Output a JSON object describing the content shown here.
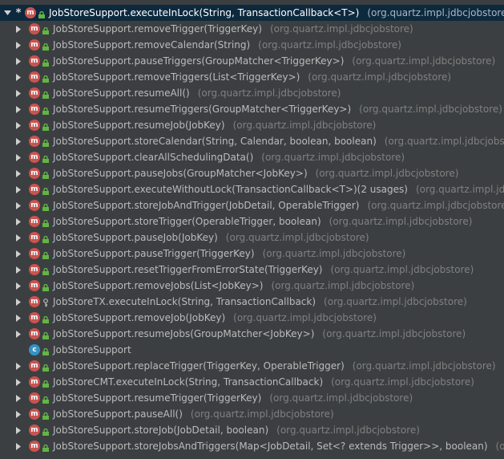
{
  "colors": {
    "background": "#3c3f41",
    "selection": "#0d293e",
    "method_badge": "#c75450",
    "class_badge": "#3592c4",
    "lock_icon": "#62b543",
    "text": "#bbbbbb",
    "package_text": "#808080"
  },
  "root": {
    "star": "*",
    "badge": "m",
    "label": "JobStoreSupport.executeInLock(String, TransactionCallback<T>)",
    "package": "(org.quartz.impl.jdbcjobstore)"
  },
  "items": [
    {
      "label": "JobStoreSupport.removeTrigger(TriggerKey)",
      "package": "(org.quartz.impl.jdbcjobstore)",
      "expandable": true,
      "badge": "m",
      "access": "lock"
    },
    {
      "label": "JobStoreSupport.removeCalendar(String)",
      "package": "(org.quartz.impl.jdbcjobstore)",
      "expandable": true,
      "badge": "m",
      "access": "lock"
    },
    {
      "label": "JobStoreSupport.pauseTriggers(GroupMatcher<TriggerKey>)",
      "package": "(org.quartz.impl.jdbcjobstore)",
      "expandable": true,
      "badge": "m",
      "access": "lock"
    },
    {
      "label": "JobStoreSupport.removeTriggers(List<TriggerKey>)",
      "package": "(org.quartz.impl.jdbcjobstore)",
      "expandable": true,
      "badge": "m",
      "access": "lock"
    },
    {
      "label": "JobStoreSupport.resumeAll()",
      "package": "(org.quartz.impl.jdbcjobstore)",
      "expandable": true,
      "badge": "m",
      "access": "lock"
    },
    {
      "label": "JobStoreSupport.resumeTriggers(GroupMatcher<TriggerKey>)",
      "package": "(org.quartz.impl.jdbcjobstore)",
      "expandable": true,
      "badge": "m",
      "access": "lock"
    },
    {
      "label": "JobStoreSupport.resumeJob(JobKey)",
      "package": "(org.quartz.impl.jdbcjobstore)",
      "expandable": true,
      "badge": "m",
      "access": "lock"
    },
    {
      "label": "JobStoreSupport.storeCalendar(String, Calendar, boolean, boolean)",
      "package": "(org.quartz.impl.jdbcjobstore)",
      "expandable": true,
      "badge": "m",
      "access": "lock"
    },
    {
      "label": "JobStoreSupport.clearAllSchedulingData()",
      "package": "(org.quartz.impl.jdbcjobstore)",
      "expandable": true,
      "badge": "m",
      "access": "lock"
    },
    {
      "label": "JobStoreSupport.pauseJobs(GroupMatcher<JobKey>)",
      "package": "(org.quartz.impl.jdbcjobstore)",
      "expandable": true,
      "badge": "m",
      "access": "lock"
    },
    {
      "label": "JobStoreSupport.executeWithoutLock(TransactionCallback<T>)(2 usages)",
      "package": "(org.quartz.impl.jdbcjobstore)",
      "expandable": true,
      "badge": "m",
      "access": "lock"
    },
    {
      "label": "JobStoreSupport.storeJobAndTrigger(JobDetail, OperableTrigger)",
      "package": "(org.quartz.impl.jdbcjobstore)",
      "expandable": true,
      "badge": "m",
      "access": "lock"
    },
    {
      "label": "JobStoreSupport.storeTrigger(OperableTrigger, boolean)",
      "package": "(org.quartz.impl.jdbcjobstore)",
      "expandable": true,
      "badge": "m",
      "access": "lock"
    },
    {
      "label": "JobStoreSupport.pauseJob(JobKey)",
      "package": "(org.quartz.impl.jdbcjobstore)",
      "expandable": true,
      "badge": "m",
      "access": "lock"
    },
    {
      "label": "JobStoreSupport.pauseTrigger(TriggerKey)",
      "package": "(org.quartz.impl.jdbcjobstore)",
      "expandable": true,
      "badge": "m",
      "access": "lock"
    },
    {
      "label": "JobStoreSupport.resetTriggerFromErrorState(TriggerKey)",
      "package": "(org.quartz.impl.jdbcjobstore)",
      "expandable": true,
      "badge": "m",
      "access": "lock"
    },
    {
      "label": "JobStoreSupport.removeJobs(List<JobKey>)",
      "package": "(org.quartz.impl.jdbcjobstore)",
      "expandable": true,
      "badge": "m",
      "access": "lock"
    },
    {
      "label": "JobStoreTX.executeInLock(String, TransactionCallback)",
      "package": "(org.quartz.impl.jdbcjobstore)",
      "expandable": true,
      "badge": "m",
      "access": "key"
    },
    {
      "label": "JobStoreSupport.removeJob(JobKey)",
      "package": "(org.quartz.impl.jdbcjobstore)",
      "expandable": true,
      "badge": "m",
      "access": "lock"
    },
    {
      "label": "JobStoreSupport.resumeJobs(GroupMatcher<JobKey>)",
      "package": "(org.quartz.impl.jdbcjobstore)",
      "expandable": true,
      "badge": "m",
      "access": "lock"
    },
    {
      "label": "JobStoreSupport",
      "package": "",
      "expandable": false,
      "badge": "c",
      "access": "lock"
    },
    {
      "label": "JobStoreSupport.replaceTrigger(TriggerKey, OperableTrigger)",
      "package": "(org.quartz.impl.jdbcjobstore)",
      "expandable": true,
      "badge": "m",
      "access": "lock"
    },
    {
      "label": "JobStoreCMT.executeInLock(String, TransactionCallback)",
      "package": "(org.quartz.impl.jdbcjobstore)",
      "expandable": true,
      "badge": "m",
      "access": "lock"
    },
    {
      "label": "JobStoreSupport.resumeTrigger(TriggerKey)",
      "package": "(org.quartz.impl.jdbcjobstore)",
      "expandable": true,
      "badge": "m",
      "access": "lock"
    },
    {
      "label": "JobStoreSupport.pauseAll()",
      "package": "(org.quartz.impl.jdbcjobstore)",
      "expandable": true,
      "badge": "m",
      "access": "lock"
    },
    {
      "label": "JobStoreSupport.storeJob(JobDetail, boolean)",
      "package": "(org.quartz.impl.jdbcjobstore)",
      "expandable": true,
      "badge": "m",
      "access": "lock"
    },
    {
      "label": "JobStoreSupport.storeJobsAndTriggers(Map<JobDetail, Set<? extends Trigger>>, boolean)",
      "package": "(o",
      "expandable": true,
      "badge": "m",
      "access": "lock"
    }
  ]
}
